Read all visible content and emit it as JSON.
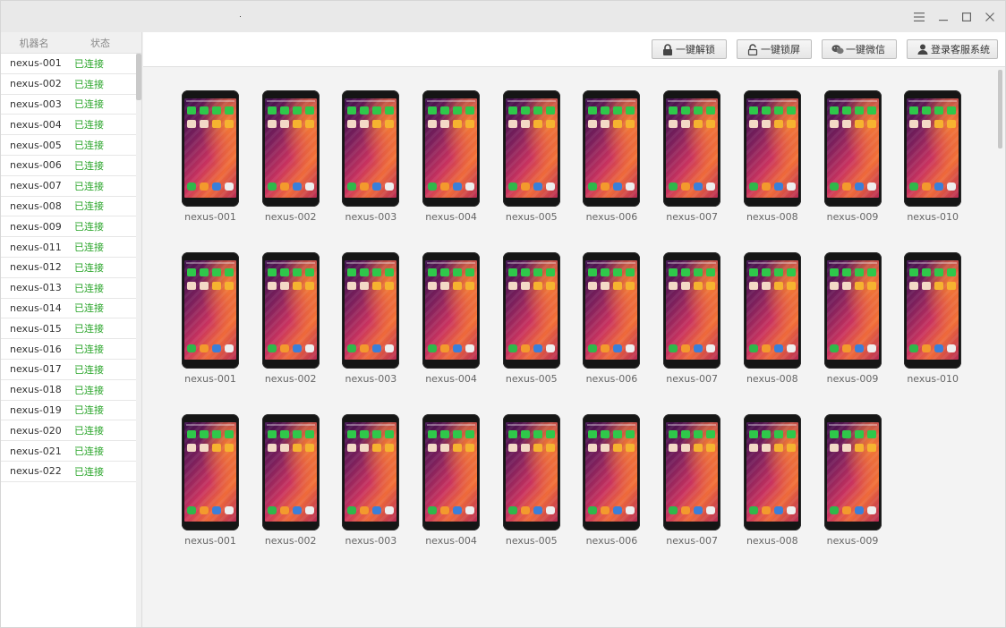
{
  "window": {
    "controls": [
      "menu-icon",
      "minimize-icon",
      "maximize-icon",
      "close-icon"
    ]
  },
  "sidebar": {
    "header": {
      "name": "机器名",
      "status": "状态"
    },
    "items": [
      {
        "name": "nexus-001",
        "status": "已连接"
      },
      {
        "name": "nexus-002",
        "status": "已连接"
      },
      {
        "name": "nexus-003",
        "status": "已连接"
      },
      {
        "name": "nexus-004",
        "status": "已连接"
      },
      {
        "name": "nexus-005",
        "status": "已连接"
      },
      {
        "name": "nexus-006",
        "status": "已连接"
      },
      {
        "name": "nexus-007",
        "status": "已连接"
      },
      {
        "name": "nexus-008",
        "status": "已连接"
      },
      {
        "name": "nexus-009",
        "status": "已连接"
      },
      {
        "name": "nexus-011",
        "status": "已连接"
      },
      {
        "name": "nexus-012",
        "status": "已连接"
      },
      {
        "name": "nexus-013",
        "status": "已连接"
      },
      {
        "name": "nexus-014",
        "status": "已连接"
      },
      {
        "name": "nexus-015",
        "status": "已连接"
      },
      {
        "name": "nexus-016",
        "status": "已连接"
      },
      {
        "name": "nexus-017",
        "status": "已连接"
      },
      {
        "name": "nexus-018",
        "status": "已连接"
      },
      {
        "name": "nexus-019",
        "status": "已连接"
      },
      {
        "name": "nexus-020",
        "status": "已连接"
      },
      {
        "name": "nexus-021",
        "status": "已连接"
      },
      {
        "name": "nexus-022",
        "status": "已连接"
      }
    ],
    "status_color": "#2aa52a"
  },
  "toolbar": {
    "unlock_label": "一键解锁",
    "lock_label": "一键锁屏",
    "wechat_label": "一键微信",
    "login_label": "登录客服系统"
  },
  "devices": [
    "nexus-001",
    "nexus-002",
    "nexus-003",
    "nexus-004",
    "nexus-005",
    "nexus-006",
    "nexus-007",
    "nexus-008",
    "nexus-009",
    "nexus-010",
    "nexus-001",
    "nexus-002",
    "nexus-003",
    "nexus-004",
    "nexus-005",
    "nexus-006",
    "nexus-007",
    "nexus-008",
    "nexus-009",
    "nexus-010",
    "nexus-001",
    "nexus-002",
    "nexus-003",
    "nexus-004",
    "nexus-005",
    "nexus-006",
    "nexus-007",
    "nexus-008",
    "nexus-009"
  ]
}
